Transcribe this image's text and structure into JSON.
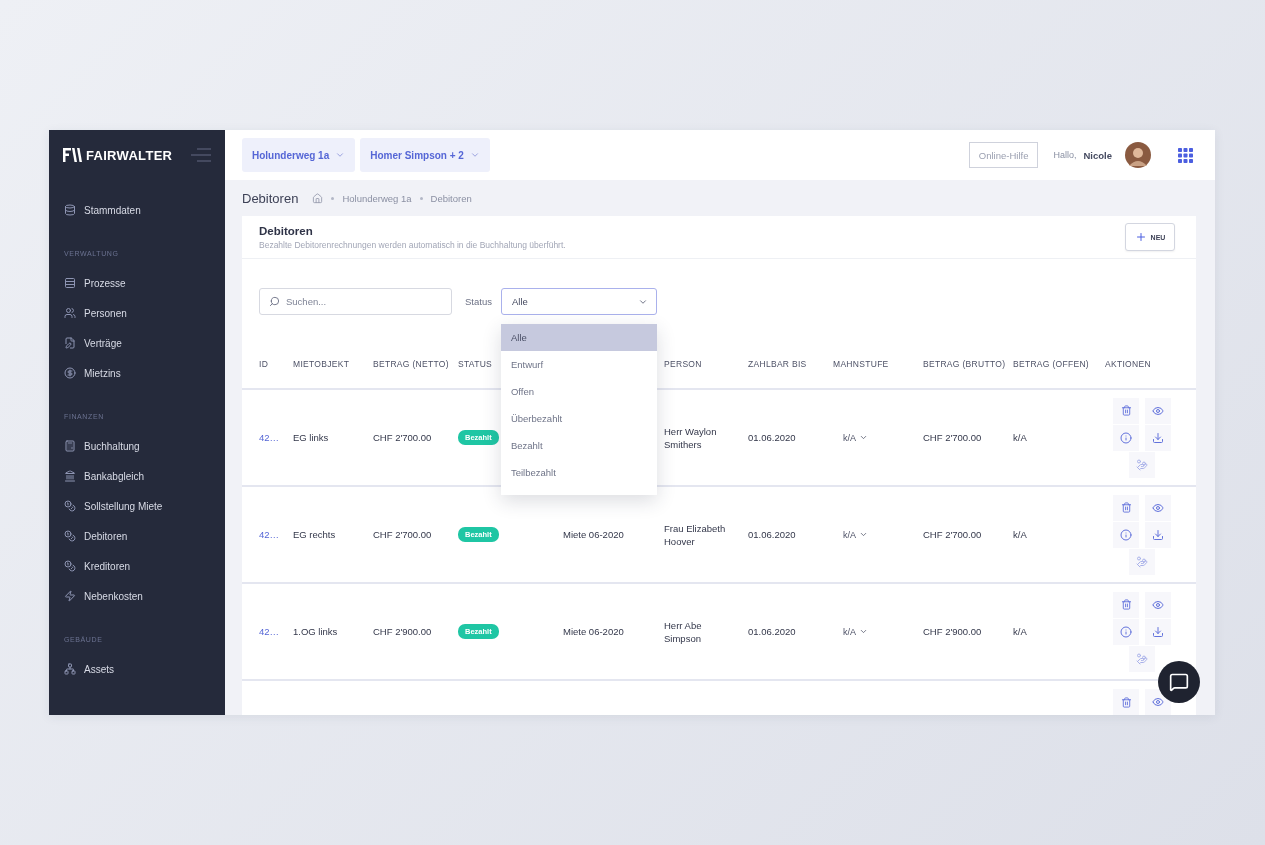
{
  "sidebar": {
    "logo": "FAIRWALTER",
    "sections": [
      {
        "items": [
          {
            "label": "Stammdaten",
            "selected": false
          }
        ]
      },
      {
        "heading": "VERWALTUNG",
        "items": [
          {
            "label": "Prozesse",
            "selected": false
          },
          {
            "label": "Personen",
            "selected": false
          },
          {
            "label": "Verträge",
            "selected": false
          },
          {
            "label": "Mietzins",
            "selected": false
          }
        ]
      },
      {
        "heading": "FINANZEN",
        "items": [
          {
            "label": "Buchhaltung",
            "selected": false
          },
          {
            "label": "Bankabgleich",
            "selected": false
          },
          {
            "label": "Sollstellung Miete",
            "selected": false
          },
          {
            "label": "Debitoren",
            "selected": false
          },
          {
            "label": "Kreditoren",
            "selected": false
          },
          {
            "label": "Nebenkosten",
            "selected": false
          }
        ]
      },
      {
        "heading": "GEBÄUDE",
        "items": [
          {
            "label": "Assets",
            "selected": false
          }
        ]
      }
    ]
  },
  "topbar": {
    "selectors": [
      "Holunderweg 1a",
      "Homer Simpson + 2"
    ],
    "help_button": "Online-Hilfe",
    "greeting": "Hallo,",
    "user_name": "Nicole"
  },
  "page": {
    "title": "Debitoren",
    "breadcrumb": [
      "Holunderweg 1a",
      "Debitoren"
    ]
  },
  "card": {
    "title": "Debitoren",
    "subtitle": "Bezahlte Debitorenrechnungen werden automatisch in die Buchhaltung überführt.",
    "new_button": "NEU"
  },
  "filters": {
    "search": {
      "placeholder": "Suchen..."
    },
    "status_label": "Status",
    "status_value": "Alle",
    "status_menu": [
      {
        "label": "Alle",
        "selected": true
      },
      {
        "label": "Entwurf",
        "selected": false
      },
      {
        "label": "Offen",
        "selected": false
      },
      {
        "label": "Überbezahlt",
        "selected": false
      },
      {
        "label": "Bezahlt",
        "selected": false
      },
      {
        "label": "Teilbezahlt",
        "selected": false
      }
    ]
  },
  "table": {
    "columns": [
      "ID",
      "MIETOBJEKT",
      "BETRAG (NETTO)",
      "STATUS",
      null,
      "PERSON",
      "ZAHLBAR BIS",
      "MAHNSTUFE",
      "BETRAG (BRUTTO)",
      "BETRAG (OFFEN)",
      "AKTIONEN"
    ],
    "rows": [
      {
        "id": "42…",
        "object": "EG links",
        "netto": "CHF 2'700.00",
        "status": "Bezahlt",
        "person": "Herr Waylon Smithers",
        "due": "01.06.2020",
        "dunning": "k/A",
        "brutto": "CHF 2'700.00",
        "open": "k/A"
      },
      {
        "id": "42…",
        "object": "EG rechts",
        "netto": "CHF 2'700.00",
        "status": "Bezahlt",
        "invoice": "Miete 06-2020",
        "person": "Frau Elizabeth Hoover",
        "due": "01.06.2020",
        "dunning": "k/A",
        "brutto": "CHF 2'700.00",
        "open": "k/A"
      },
      {
        "id": "42…",
        "object": "1.OG links",
        "netto": "CHF 2'900.00",
        "status": "Bezahlt",
        "invoice": "Miete 06-2020",
        "person": "Herr Abe Simpson",
        "due": "01.06.2020",
        "dunning": "k/A",
        "brutto": "CHF 2'900.00",
        "open": "k/A"
      },
      {}
    ]
  }
}
